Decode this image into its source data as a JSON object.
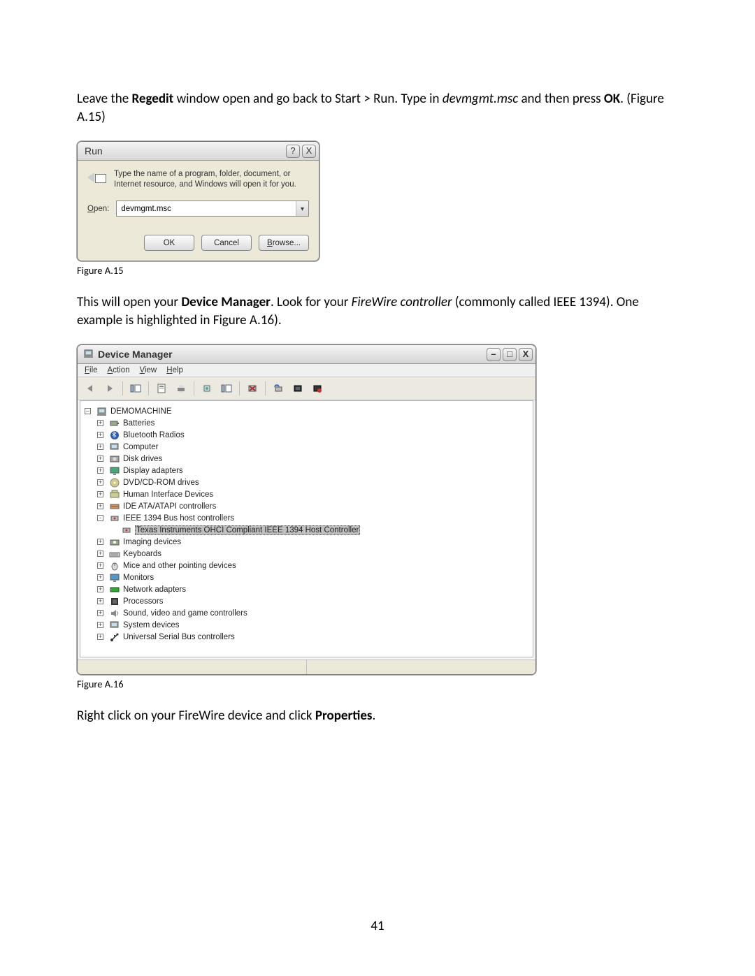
{
  "paragraph1_parts": {
    "a": "Leave the ",
    "b": "Regedit",
    "c": " window open and go back to Start > Run. Type in ",
    "d": "devmgmt.msc",
    "e": " and then press ",
    "f": "OK",
    "g": ". (Figure A.15)"
  },
  "run": {
    "title": "Run",
    "help_glyph": "?",
    "close_glyph": "X",
    "message": "Type the name of a program, folder, document, or Internet resource, and Windows will open it for you.",
    "open_label_underline": "O",
    "open_label_rest": "pen:",
    "value": "devmgmt.msc",
    "dropdown_glyph": "▾",
    "buttons": {
      "ok": "OK",
      "cancel": "Cancel",
      "browse_ul": "B",
      "browse_rest": "rowse..."
    }
  },
  "caption1": "Figure A.15",
  "paragraph2_parts": {
    "a": "This will open your ",
    "b": "Device Manager",
    "c": ". Look for your ",
    "d": "FireWire controller",
    "e": " (commonly called IEEE 1394). One example is highlighted in Figure A.16)."
  },
  "dm": {
    "title": "Device Manager",
    "min_glyph": "–",
    "max_glyph": "□",
    "close_glyph": "X",
    "menus": [
      {
        "ul": "F",
        "rest": "ile"
      },
      {
        "ul": "A",
        "rest": "ction"
      },
      {
        "ul": "V",
        "rest": "iew"
      },
      {
        "ul": "H",
        "rest": "elp"
      }
    ],
    "root": "DEMOMACHINE",
    "nodes": [
      {
        "pm": "+",
        "icon": "battery",
        "label": "Batteries"
      },
      {
        "pm": "+",
        "icon": "bluetooth",
        "label": "Bluetooth Radios"
      },
      {
        "pm": "+",
        "icon": "computer",
        "label": "Computer"
      },
      {
        "pm": "+",
        "icon": "disk",
        "label": "Disk drives"
      },
      {
        "pm": "+",
        "icon": "display",
        "label": "Display adapters"
      },
      {
        "pm": "+",
        "icon": "cd",
        "label": "DVD/CD-ROM drives"
      },
      {
        "pm": "+",
        "icon": "hid",
        "label": "Human Interface Devices"
      },
      {
        "pm": "+",
        "icon": "ide",
        "label": "IDE ATA/ATAPI controllers"
      },
      {
        "pm": "-",
        "icon": "fw",
        "label": "IEEE 1394 Bus host controllers",
        "children": [
          {
            "icon": "fw",
            "label": "Texas Instruments OHCI Compliant IEEE 1394 Host Controller",
            "highlighted": true
          }
        ]
      },
      {
        "pm": "+",
        "icon": "imaging",
        "label": "Imaging devices"
      },
      {
        "pm": "+",
        "icon": "keyboard",
        "label": "Keyboards"
      },
      {
        "pm": "+",
        "icon": "mouse",
        "label": "Mice and other pointing devices"
      },
      {
        "pm": "+",
        "icon": "monitor",
        "label": "Monitors"
      },
      {
        "pm": "+",
        "icon": "network",
        "label": "Network adapters"
      },
      {
        "pm": "+",
        "icon": "cpu",
        "label": "Processors"
      },
      {
        "pm": "+",
        "icon": "sound",
        "label": "Sound, video and game controllers"
      },
      {
        "pm": "+",
        "icon": "system",
        "label": "System devices"
      },
      {
        "pm": "+",
        "icon": "usb",
        "label": "Universal Serial Bus controllers"
      }
    ]
  },
  "caption2": "Figure A.16",
  "paragraph3_parts": {
    "a": "Right click on your FireWire device and click ",
    "b": "Properties",
    "c": "."
  },
  "page_number": "41"
}
